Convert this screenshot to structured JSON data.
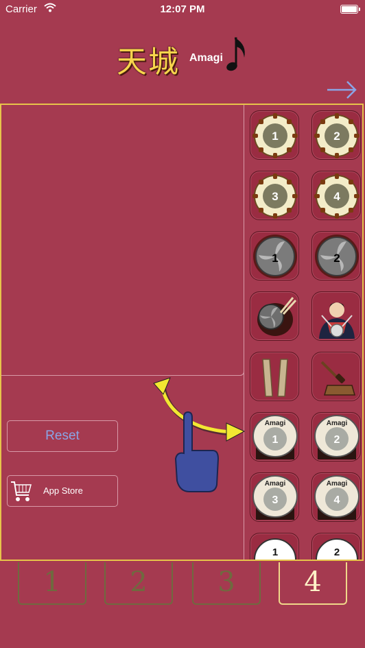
{
  "status_bar": {
    "carrier": "Carrier",
    "time": "12:07 PM"
  },
  "logo": {
    "kanji": "天城",
    "text": "Amagi"
  },
  "controls": {
    "reset_label": "Reset",
    "app_store_label": "App Store"
  },
  "instruments": [
    {
      "icon": "drum-head-icon",
      "label": "1"
    },
    {
      "icon": "drum-head-icon",
      "label": "2"
    },
    {
      "icon": "drum-head-icon",
      "label": "3"
    },
    {
      "icon": "drum-head-icon",
      "label": "4"
    },
    {
      "icon": "tomoe-drum-icon",
      "label": "1"
    },
    {
      "icon": "tomoe-drum-icon",
      "label": "2"
    },
    {
      "icon": "hand-drum-icon",
      "label": ""
    },
    {
      "icon": "drummer-icon",
      "label": ""
    },
    {
      "icon": "wood-clappers-icon",
      "label": ""
    },
    {
      "icon": "hammer-bell-icon",
      "label": ""
    },
    {
      "icon": "taiko-drum-icon",
      "label": "1",
      "brand": "Amagi"
    },
    {
      "icon": "taiko-drum-icon",
      "label": "2",
      "brand": "Amagi"
    },
    {
      "icon": "taiko-drum-icon",
      "label": "3",
      "brand": "Amagi"
    },
    {
      "icon": "taiko-drum-icon",
      "label": "4",
      "brand": "Amagi"
    },
    {
      "icon": "white-drum-icon",
      "label": "1"
    },
    {
      "icon": "white-drum-icon",
      "label": "2"
    }
  ],
  "tabs": [
    {
      "label": "1",
      "active": false
    },
    {
      "label": "2",
      "active": false
    },
    {
      "label": "3",
      "active": false
    },
    {
      "label": "4",
      "active": true
    }
  ],
  "colors": {
    "background": "#a53a50",
    "frame": "#e7c44a",
    "link": "#8aa5e6",
    "gesture_arrow": "#f2e832",
    "hand": "#3f4fa0"
  }
}
